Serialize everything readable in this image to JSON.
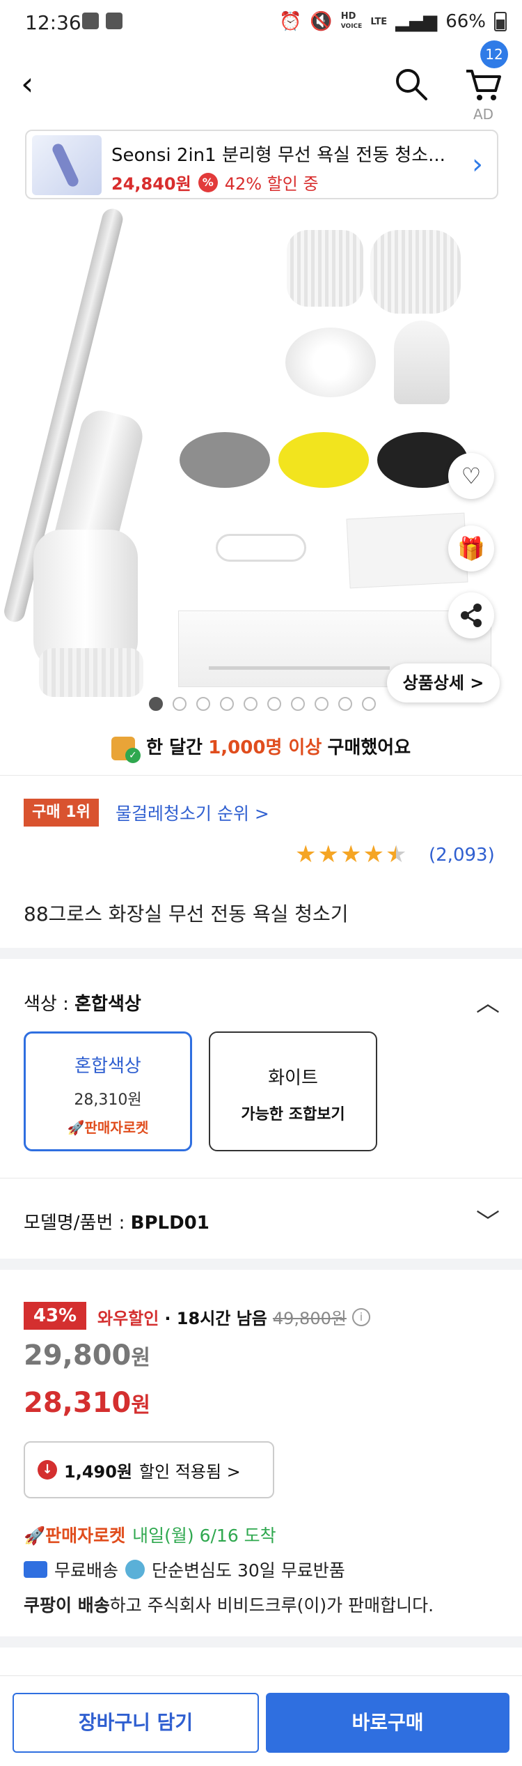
{
  "status_bar": {
    "time": "12:36",
    "battery": "66%",
    "hd_label": "HD",
    "voice_label": "VOICE",
    "lte_label": "LTE"
  },
  "header": {
    "cart_count": "12",
    "ad_label": "AD"
  },
  "ad": {
    "title": "Seonsi 2in1 분리형 무선 욕실 전동 청소...",
    "price": "24,840원",
    "discount_icon": "%",
    "discount": "42% 할인 중"
  },
  "gallery": {
    "detail_button": "상품상세 >",
    "dot_count": 10,
    "active_dot": 0
  },
  "buyers": {
    "prefix": "한 달간",
    "count": "1,000명 이상",
    "suffix": "구매했어요"
  },
  "rank": {
    "badge": "구매 1위",
    "link": "물걸레청소기 순위 >"
  },
  "rating": {
    "stars": 4.5,
    "count": "(2,093)"
  },
  "product": {
    "name": "88그로스 화장실 무선 전동 욕실 청소기"
  },
  "options": {
    "label": "색상 :",
    "selected_value": "혼합색상",
    "cards": [
      {
        "name": "혼합색상",
        "price": "28,310원",
        "rocket": "🚀판매자로켓"
      },
      {
        "name": "화이트",
        "combo": "가능한 조합보기"
      }
    ]
  },
  "model": {
    "label": "모델명/품번 :",
    "value": "BPLD01"
  },
  "price": {
    "discount_pct": "43%",
    "wow_label": "와우할인",
    "time_left": "· 18시간 남음",
    "original": "49,800원",
    "info_icon": "i",
    "sale_price": "29,800",
    "sale_unit": "원",
    "final_price": "28,310",
    "final_unit": "원",
    "coupon_icon": "↓",
    "coupon_amount": "1,490원",
    "coupon_text": "할인 적용됨 >"
  },
  "delivery": {
    "rocket": "🚀판매자로켓",
    "eta": "내일(월) 6/16 도착",
    "free_ship": "무료배송",
    "free_return": "단순변심도 30일 무료반품",
    "seller_bold": "쿠팡이 배송",
    "seller_rest": "하고 주식회사 비비드크루(이)가 판매합니다."
  },
  "bottom": {
    "cart_button": "장바구니 담기",
    "buy_button": "바로구매"
  },
  "colors": {
    "accent": "#2f6fe0",
    "sale_red": "#d42f2f",
    "rocket_orange": "#e04d1d",
    "star": "#f5a524",
    "eta_green": "#2fa84f"
  }
}
